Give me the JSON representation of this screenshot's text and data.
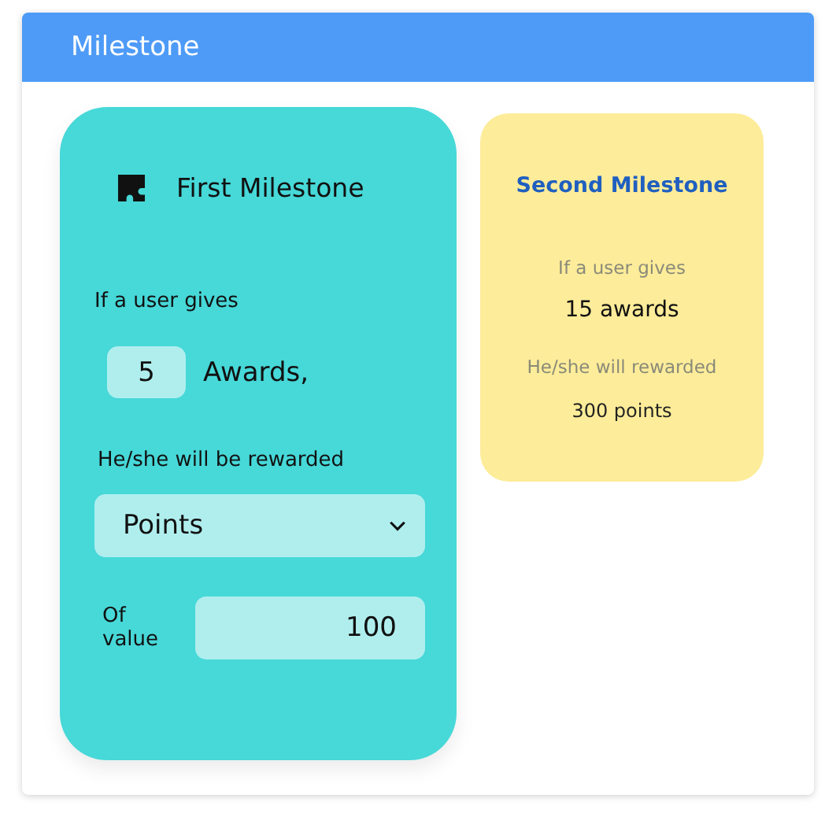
{
  "window": {
    "title": "Milestone"
  },
  "first_milestone": {
    "title": "First Milestone",
    "condition_label": "If a user gives",
    "awards_count": "5",
    "awards_label": "Awards,",
    "reward_label": "He/she will be rewarded",
    "reward_type": "Points",
    "value_label": "Of value",
    "value": "100"
  },
  "second_milestone": {
    "title": "Second Milestone",
    "condition_label": "If a user gives",
    "awards": "15 awards",
    "reward_label": "He/she will rewarded",
    "reward": "300 points"
  }
}
